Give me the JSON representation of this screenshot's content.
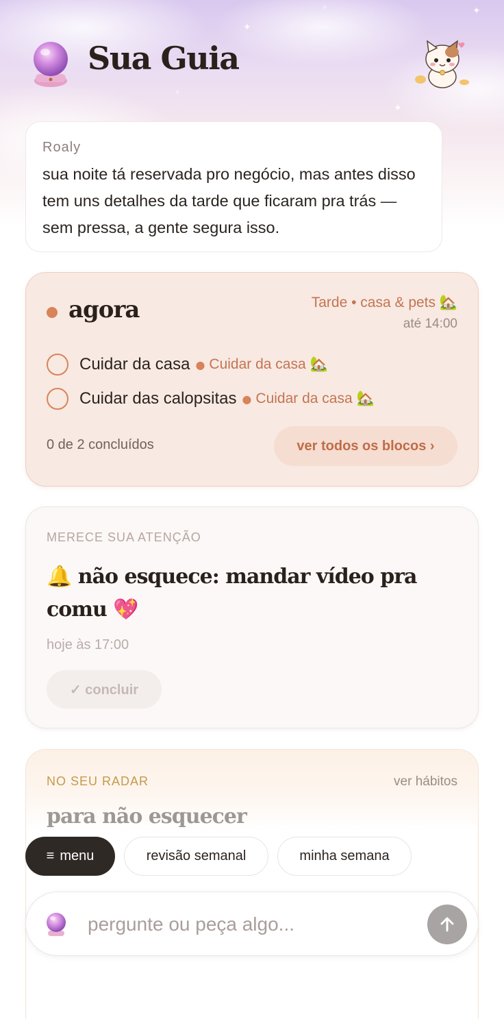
{
  "header": {
    "title": "Sua Guia",
    "orb_icon": "crystal-ball-icon",
    "mascot_icon": "cat-mascot-icon"
  },
  "message": {
    "author": "Roaly",
    "text": "sua noite tá reservada pro negócio, mas antes disso tem uns detalhes da tarde que ficaram pra trás — sem pressa, a gente segura isso."
  },
  "now": {
    "title": "agora",
    "block_name": "Tarde • casa & pets 🏡",
    "block_until": "até 14:00",
    "tasks": [
      {
        "label": "Cuidar da casa",
        "tag": "Cuidar da casa 🏡"
      },
      {
        "label": "Cuidar das calopsitas",
        "tag": "Cuidar da casa 🏡"
      }
    ],
    "progress": "0 de 2 concluídos",
    "blocks_button": "ver todos os blocos ›",
    "accent": "#d88359"
  },
  "attention": {
    "label": "MERECE SUA ATENÇÃO",
    "title": "🔔 não esquece: mandar vídeo pra comu 💖",
    "time": "hoje às 17:00",
    "done_button": "✓ concluir"
  },
  "radar": {
    "label": "NO SEU RADAR",
    "link": "ver hábitos",
    "title": "para não esquecer"
  },
  "chips": {
    "menu": "menu",
    "review": "revisão semanal",
    "week": "minha semana"
  },
  "ask": {
    "placeholder": "pergunte ou peça algo...",
    "value": ""
  }
}
